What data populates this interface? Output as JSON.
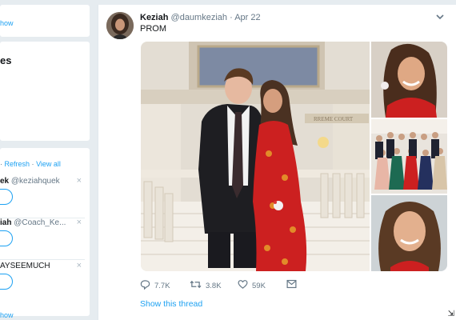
{
  "sidebar": {
    "card1": {
      "show_more": "how"
    },
    "trends": {
      "title": "es"
    },
    "who_to_follow": {
      "prefix": "·",
      "refresh": "Refresh",
      "separator": "·",
      "view_all": "View all",
      "suggestions": [
        {
          "name": "ek",
          "handle": "@keziahquek",
          "dismiss": "×"
        },
        {
          "name": "iah",
          "handle": "@Coach_Ke...",
          "dismiss": "×"
        },
        {
          "name": "AYSEEMUCH",
          "handle": "",
          "dismiss": "×"
        }
      ],
      "footer_link": "how"
    }
  },
  "tweet": {
    "author_name": "Keziah",
    "author_handle": "@daumkeziah",
    "separator": "·",
    "date": "Apr 22",
    "text": "PROM",
    "photo_sign": "RREME COURT",
    "actions": {
      "replies": "7.7K",
      "retweets": "3.8K",
      "likes": "59K"
    },
    "show_thread": "Show this thread"
  },
  "icons": {
    "avatar": "avatar",
    "chevron": "chevron-down-icon",
    "reply": "reply-icon",
    "retweet": "retweet-icon",
    "like": "heart-icon",
    "message": "message-icon",
    "dismiss": "close-icon"
  },
  "colors": {
    "accent": "#1da1f2",
    "background": "#e6ecf0",
    "dress_red": "#cc2020"
  }
}
